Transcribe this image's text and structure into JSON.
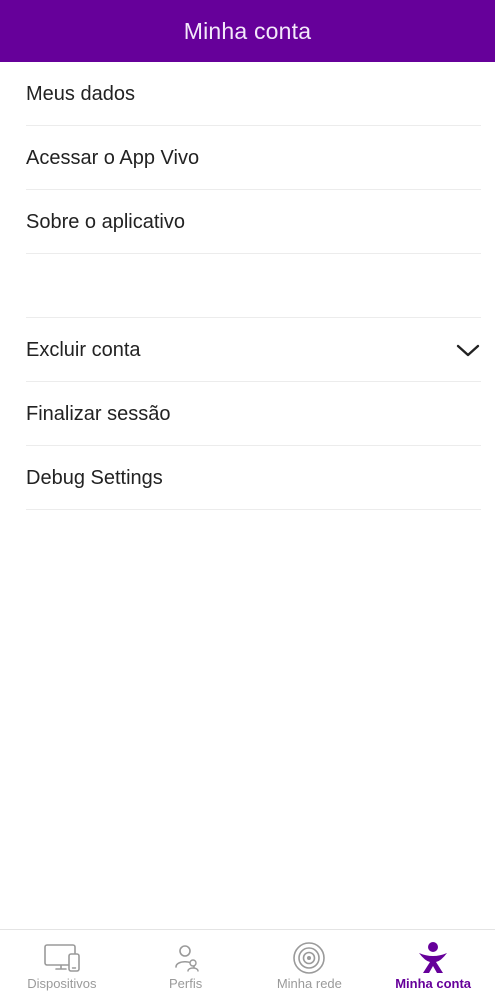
{
  "header": {
    "title": "Minha conta"
  },
  "menu": {
    "items": [
      {
        "label": "Meus dados"
      },
      {
        "label": "Acessar o App Vivo"
      },
      {
        "label": "Sobre o aplicativo"
      },
      {
        "label": ""
      },
      {
        "label": "Excluir conta"
      },
      {
        "label": "Finalizar sessão"
      },
      {
        "label": "Debug Settings"
      }
    ],
    "expand_icon": "chevron-down-icon"
  },
  "tabbar": {
    "tabs": [
      {
        "label": "Dispositivos",
        "icon": "devices-icon",
        "active": false
      },
      {
        "label": "Perfis",
        "icon": "profiles-icon",
        "active": false
      },
      {
        "label": "Minha rede",
        "icon": "network-icon",
        "active": false
      },
      {
        "label": "Minha conta",
        "icon": "vivo-account-icon",
        "active": true
      }
    ]
  },
  "colors": {
    "brand": "#66009a",
    "inactive": "#9a9a9a"
  }
}
